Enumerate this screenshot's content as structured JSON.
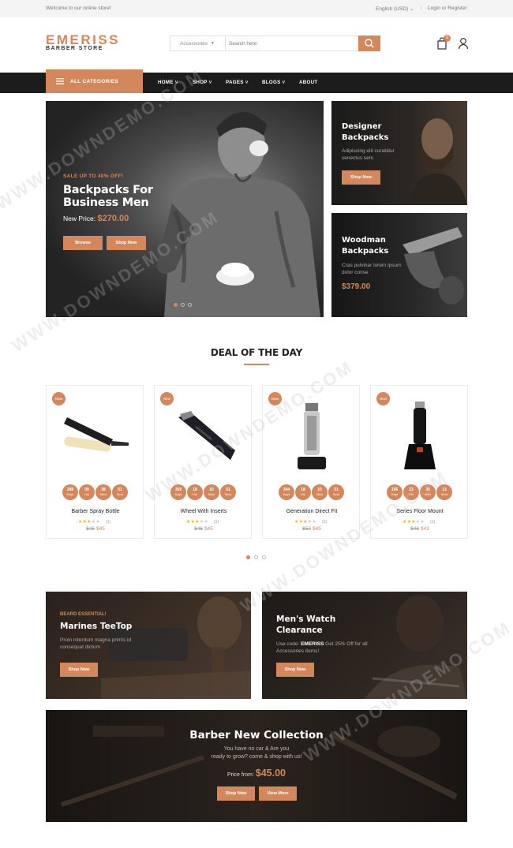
{
  "topbar": {
    "welcome": "Welcome to our online store!",
    "language": "English (USD)",
    "login": "Login or Register"
  },
  "header": {
    "logo_main": "EMERISS",
    "logo_sub": "BARBER STORE",
    "search_category": "Accessories",
    "search_placeholder": "Search here",
    "cart_count": "0"
  },
  "nav": {
    "all_categories": "ALL CATEGORIES",
    "items": [
      {
        "label": "HOME",
        "has_dropdown": true
      },
      {
        "label": "SHOP",
        "has_dropdown": true
      },
      {
        "label": "PAGES",
        "has_dropdown": true
      },
      {
        "label": "BLOGS",
        "has_dropdown": true
      },
      {
        "label": "ABOUT",
        "has_dropdown": false
      }
    ]
  },
  "hero": {
    "tag": "SALE UP TO 40% OFF!",
    "title": "Backpacks For Business Men",
    "price_label": "New Price:",
    "price": "$270.00",
    "button_browse": "Browse",
    "button_shop": "Shop Now"
  },
  "side_banners": [
    {
      "title": "Designer Backpacks",
      "desc": "Adipiscing elit curabitur senectus sem",
      "button": "Shop Now"
    },
    {
      "title": "Woodman Backpacks",
      "desc": "Cras pulvinar lorem ipsum dolor conse",
      "price": "$379.00"
    }
  ],
  "deal": {
    "title": "DEAL OF THE DAY",
    "products": [
      {
        "badge": "New",
        "name": "Barber Spray Bottle",
        "rating": 3,
        "reviews": "(1)",
        "old_price": "$46",
        "new_price": "$45",
        "countdown": [
          {
            "n": "298",
            "u": "Days"
          },
          {
            "n": "09",
            "u": "Hrs"
          },
          {
            "n": "38",
            "u": "Mins"
          },
          {
            "n": "51",
            "u": "Secs"
          }
        ]
      },
      {
        "badge": "New",
        "name": "Wheel With Inserts",
        "rating": 3,
        "reviews": "(1)",
        "old_price": "$46",
        "new_price": "$45",
        "countdown": [
          {
            "n": "359",
            "u": "Days"
          },
          {
            "n": "18",
            "u": "Hrs"
          },
          {
            "n": "10",
            "u": "Mins"
          },
          {
            "n": "51",
            "u": "Secs"
          }
        ]
      },
      {
        "badge": "New",
        "name": "Generation Direct Fit",
        "rating": 3,
        "reviews": "(1)",
        "old_price": "$50",
        "new_price": "$45",
        "countdown": [
          {
            "n": "344",
            "u": "Days"
          },
          {
            "n": "18",
            "u": "Hrs"
          },
          {
            "n": "10",
            "u": "Mins"
          },
          {
            "n": "51",
            "u": "Secs"
          }
        ]
      },
      {
        "badge": "New",
        "name": "Series Floor Mount",
        "rating": 3,
        "reviews": "(1)",
        "old_price": "$46",
        "new_price": "$43",
        "countdown": [
          {
            "n": "196",
            "u": "Days"
          },
          {
            "n": "23",
            "u": "Hrs"
          },
          {
            "n": "30",
            "u": "Mins"
          },
          {
            "n": "13",
            "u": "Secs"
          }
        ]
      }
    ]
  },
  "promo_banners": [
    {
      "subtitle": "BEARD ESSENTIAL!",
      "title": "Marines TeeTop",
      "desc": "Proin interdum magna primis id consequat dictum",
      "button": "Shop Now"
    },
    {
      "title": "Men's Watch Clearance",
      "desc_before": "Use code:",
      "code": "EMERISS",
      "desc_after": "Get 25% Off for all Accessories items!",
      "button": "Shop Now"
    }
  ],
  "collection": {
    "title": "Barber New Collection",
    "line1": "You have no car & Are you",
    "line2": "ready to grow? come & shop with us!",
    "price_label": "Price from:",
    "price": "$45.00",
    "button_shop": "Shop Now",
    "button_view": "View More"
  },
  "watermark": "WWW.DOWNDEMO.COM",
  "colors": {
    "accent": "#d4875a",
    "dark": "#1c1c1c"
  }
}
